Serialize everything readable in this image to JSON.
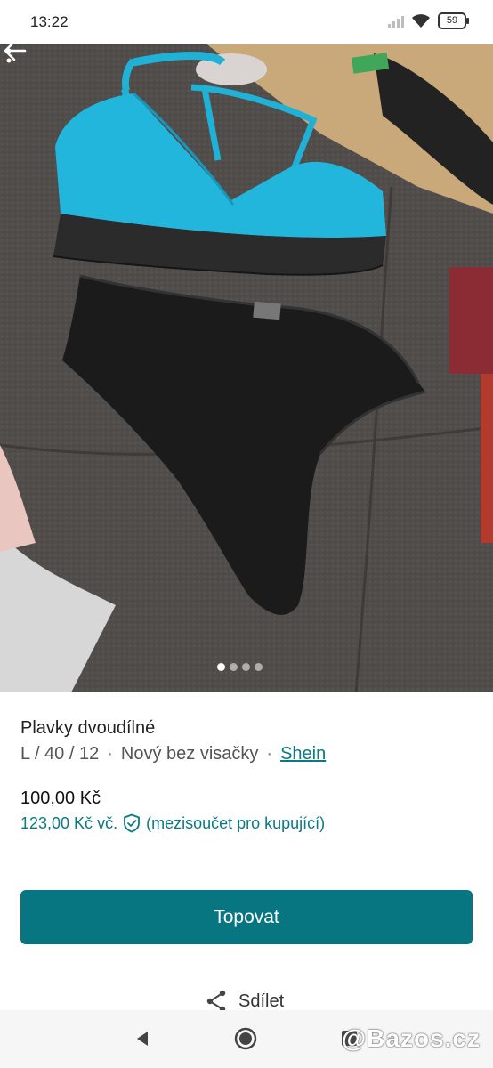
{
  "status_bar": {
    "time": "13:22",
    "battery": "59"
  },
  "listing": {
    "title": "Plavky dvoudílné",
    "size": "L / 40 / 12",
    "condition": "Nový bez visačky",
    "brand": "Shein",
    "separator": "·",
    "price": "100,00 Kč",
    "total_price": "123,00 Kč  vč.",
    "total_note": "(mezisoučet pro kupující)"
  },
  "gallery": {
    "photo_count": 4,
    "current": 1
  },
  "actions": {
    "promote_label": "Topovat",
    "share_label": "Sdílet"
  },
  "watermark": "@Bazos.cz",
  "colors": {
    "accent": "#087680",
    "link": "#0a7a86"
  },
  "icons": [
    "back-arrow-icon",
    "more-icon",
    "shield-check-icon",
    "share-icon",
    "nav-back-icon",
    "nav-home-icon",
    "nav-recents-icon"
  ]
}
